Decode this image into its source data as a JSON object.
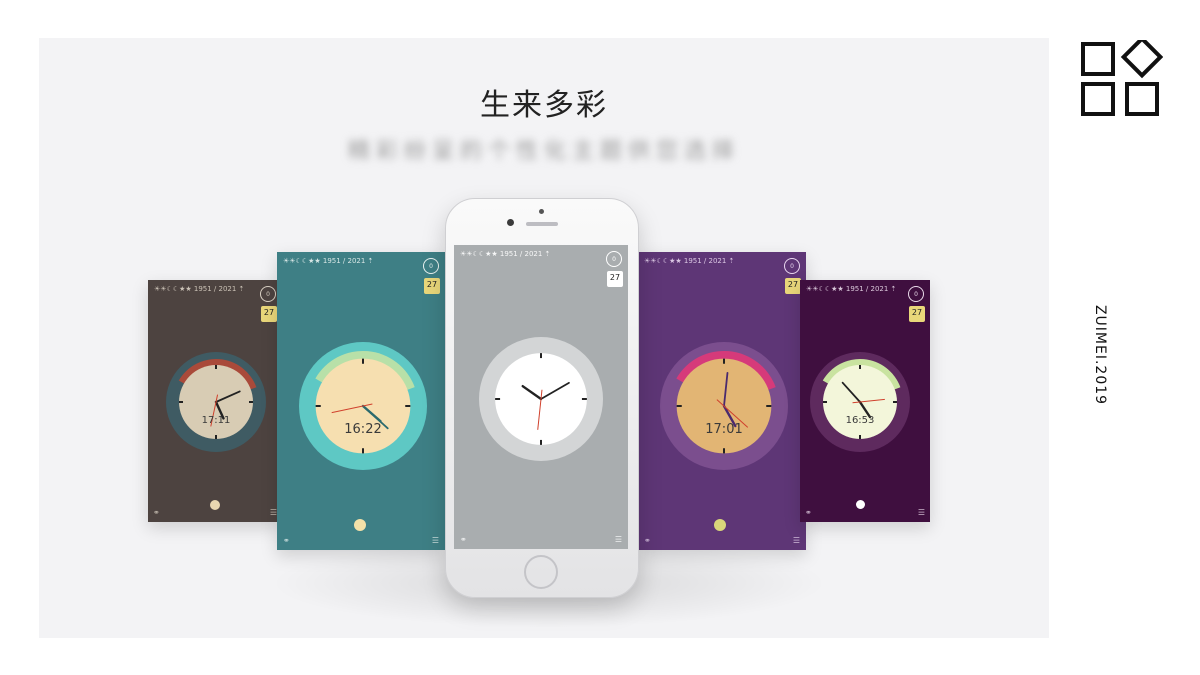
{
  "header": {
    "title": "生来多彩",
    "subtitle": "精彩纷呈的个性化主题供您选择"
  },
  "brand": {
    "side_text": "ZUIMEI.2019"
  },
  "screens": [
    {
      "id": "s1",
      "status": "☀☀☾☾★★ 1951 / 2021 ⇡",
      "badge": "0",
      "date": "27",
      "time": "17:11",
      "colors": {
        "bg": "#4d4340",
        "face": "#d8ccb4",
        "ring": "#3f5b63",
        "accent": "#a94a3a",
        "dot": "#e8d6b0",
        "text": "#d9d0c3"
      }
    },
    {
      "id": "s2",
      "status": "☀☀☾☾★★ 1951 / 2021 ⇡",
      "badge": "0",
      "date": "27",
      "time": "16:22",
      "colors": {
        "bg": "#3e7f85",
        "face": "#f6dfb0",
        "ring": "#5ec8c4",
        "accent": "#b8e0a8",
        "dot": "#f4e1a8",
        "text": "#e8f2f0"
      }
    },
    {
      "id": "s3",
      "status": "☀☀☾☾★★ 1951 / 2021 ⇡",
      "badge": "0",
      "date": "27",
      "time": "",
      "colors": {
        "bg": "#a9adaf",
        "face": "#ffffff",
        "ring": "#d3d5d6",
        "accent": "#ffffff",
        "dot": "#ffffff",
        "text": "#ffffff"
      }
    },
    {
      "id": "s4",
      "status": "☀☀☾☾★★ 1951 / 2021 ⇡",
      "badge": "0",
      "date": "27",
      "time": "17:01",
      "colors": {
        "bg": "#5e3676",
        "face": "#e2b574",
        "ring": "#7b4e8e",
        "accent": "#d63a7a",
        "dot": "#d9d67a",
        "text": "#e8d6ef"
      }
    },
    {
      "id": "s5",
      "status": "☀☀☾☾★★ 1951 / 2021 ⇡",
      "badge": "0",
      "date": "27",
      "time": "16:53",
      "colors": {
        "bg": "#3f0f3f",
        "face": "#f3f6da",
        "ring": "#5e2a5e",
        "accent": "#c9e3a0",
        "dot": "#ffffff",
        "text": "#e9d9e9"
      }
    }
  ],
  "icons": {
    "link": "link-icon",
    "list": "list-icon",
    "logo": "grid-diamond-logo"
  }
}
